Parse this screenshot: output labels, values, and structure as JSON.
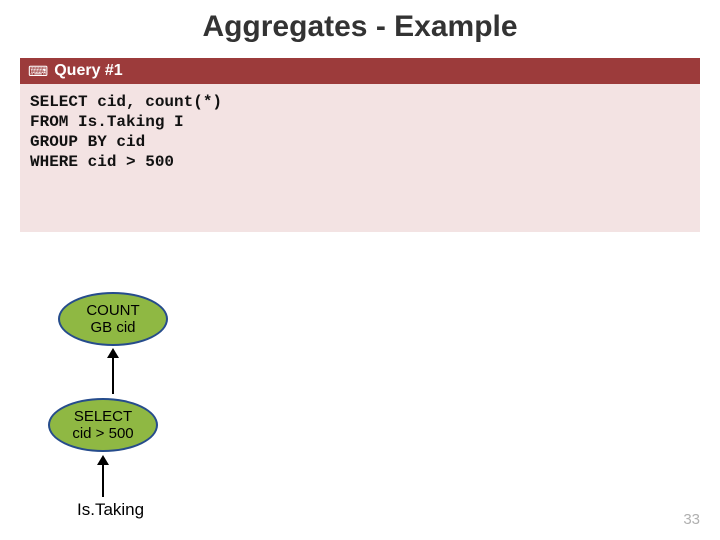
{
  "title": "Aggregates - Example",
  "bar": {
    "icon": "⌨",
    "label": "Query #1"
  },
  "code": "SELECT cid, count(*)\nFROM Is.Taking I\nGROUP BY cid\nWHERE cid > 500",
  "nodes": {
    "top": {
      "line1": "COUNT",
      "line2": "GB cid"
    },
    "bottom": {
      "line1": "SELECT",
      "line2": "cid > 500"
    }
  },
  "tableLabel": "Is.Taking",
  "pageNumber": "33"
}
